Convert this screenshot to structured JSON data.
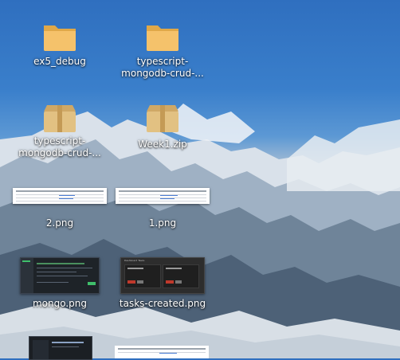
{
  "desktop": {
    "icons": [
      {
        "label": "ex5_debug",
        "type": "folder-icon"
      },
      {
        "label": "typescript-\nmongodb-crud-...",
        "type": "folder-icon"
      },
      {
        "label": "typescript-\nmongodb-crud-...",
        "type": "archive-icon"
      },
      {
        "label": "Week1.zip",
        "type": "archive-icon"
      },
      {
        "label": "2.png",
        "type": "image-thumbnail"
      },
      {
        "label": "1.png",
        "type": "image-thumbnail"
      },
      {
        "label": "mongo.png",
        "type": "image-thumbnail"
      },
      {
        "label": "tasks-created.png",
        "type": "image-thumbnail"
      }
    ]
  },
  "thumbnails": {
    "tasks_created_title": "Dashboard Tasks"
  },
  "colors": {
    "folder": "#f5c26b",
    "folder_dark": "#e0a848",
    "archive": "#e2c182",
    "label_text": "#ffffff"
  }
}
